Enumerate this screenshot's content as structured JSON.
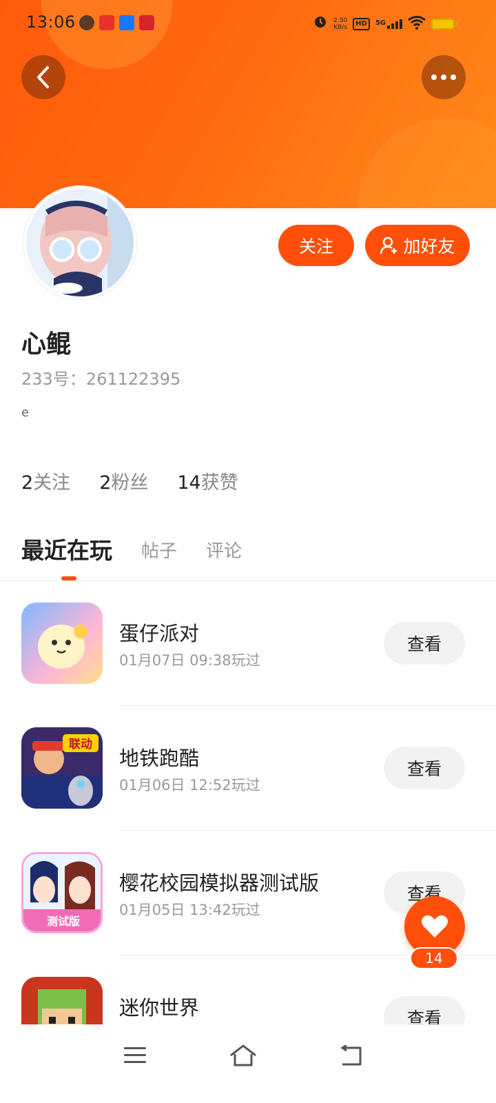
{
  "status_bar": {
    "time": "13:06",
    "net_speed_value": "2.50",
    "net_speed_unit": "KB/s",
    "hd_label": "HD",
    "network": "5G"
  },
  "profile": {
    "name": "心鲲",
    "id_label": "233号：261122395",
    "bio": "e",
    "follow_label": "关注",
    "add_friend_label": "加好友"
  },
  "stats": [
    {
      "num": "2",
      "label": "关注"
    },
    {
      "num": "2",
      "label": "粉丝"
    },
    {
      "num": "14",
      "label": "获赞"
    }
  ],
  "tabs": [
    {
      "label": "最近在玩",
      "active": true
    },
    {
      "label": "帖子",
      "active": false
    },
    {
      "label": "评论",
      "active": false
    }
  ],
  "games": [
    {
      "name": "蛋仔派对",
      "played": "01月07日 09:38玩过",
      "action": "查看"
    },
    {
      "name": "地铁跑酷",
      "played": "01月06日 12:52玩过",
      "action": "查看",
      "badge": "联动"
    },
    {
      "name": "樱花校园模拟器测试版",
      "played": "01月05日 13:42玩过",
      "action": "查看",
      "badge": "测试版"
    },
    {
      "name": "迷你世界",
      "played": "",
      "action": "查看"
    }
  ],
  "like_fab": {
    "count": "14"
  },
  "colors": {
    "accent": "#ff4f0a",
    "banner": "#ff6a10"
  }
}
